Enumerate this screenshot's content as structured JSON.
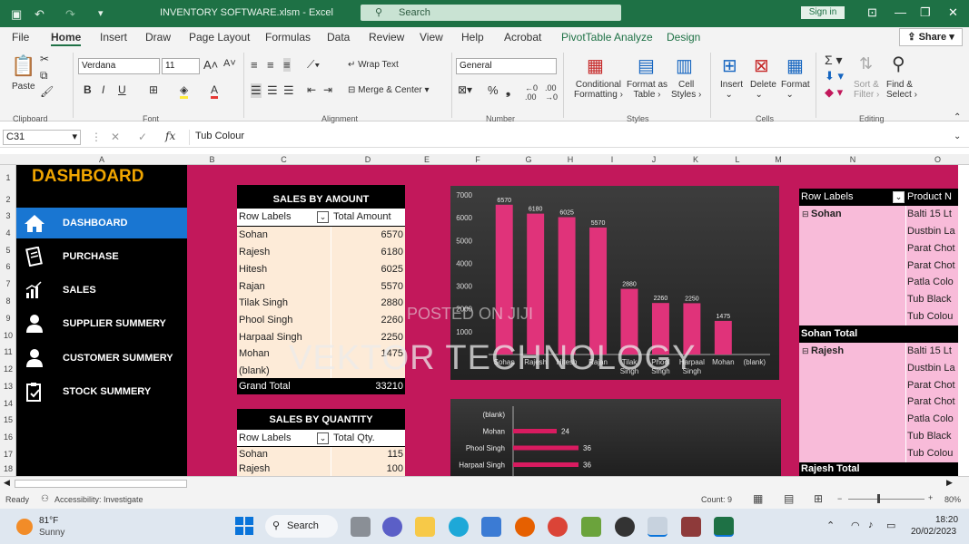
{
  "titlebar": {
    "file_title": "INVENTORY SOFTWARE.xlsm  -  Excel",
    "search_placeholder": "Search",
    "signin": "Sign in"
  },
  "tabs": [
    "File",
    "Home",
    "Insert",
    "Draw",
    "Page Layout",
    "Formulas",
    "Data",
    "Review",
    "View",
    "Help",
    "Acrobat",
    "PivotTable Analyze",
    "Design"
  ],
  "share": "Share",
  "ribbon": {
    "paste": "Paste",
    "clipboard": "Clipboard",
    "font_name": "Verdana",
    "font_size": "11",
    "font": "Font",
    "wrap_text": "Wrap Text",
    "merge_center": "Merge & Center",
    "alignment": "Alignment",
    "number_format": "General",
    "number": "Number",
    "cond_format": "Conditional",
    "cond_format2": "Formatting",
    "format_as": "Format as",
    "format_as2": "Table",
    "cell_styles": "Cell",
    "cell_styles2": "Styles",
    "styles": "Styles",
    "insert": "Insert",
    "delete": "Delete",
    "format": "Format",
    "cells": "Cells",
    "sort_filter": "Sort &",
    "sort_filter2": "Filter",
    "find_select": "Find &",
    "find_select2": "Select",
    "editing": "Editing"
  },
  "formula_bar": {
    "name_box": "C31",
    "fx": "fx",
    "formula": "Tub Colour"
  },
  "columns": [
    "A",
    "B",
    "C",
    "D",
    "E",
    "F",
    "G",
    "H",
    "I",
    "J",
    "K",
    "L",
    "M",
    "N",
    "O"
  ],
  "rows": [
    "1",
    "2",
    "3",
    "4",
    "5",
    "6",
    "7",
    "8",
    "9",
    "10",
    "11",
    "12",
    "13",
    "14",
    "15",
    "16",
    "17",
    "18"
  ],
  "dashboard": {
    "title": "DASHBOARD",
    "nav": [
      {
        "label": "DASHBOARD",
        "icon": "home-icon"
      },
      {
        "label": "PURCHASE",
        "icon": "receipt-icon"
      },
      {
        "label": "SALES",
        "icon": "bar-chart-icon"
      },
      {
        "label": "SUPPLIER SUMMERY",
        "icon": "person-icon"
      },
      {
        "label": "CUSTOMER SUMMERY",
        "icon": "person-icon"
      },
      {
        "label": "STOCK SUMMERY",
        "icon": "clipboard-check-icon"
      }
    ]
  },
  "sales_by_amount": {
    "title": "SALES BY AMOUNT",
    "col1": "Row Labels",
    "col2": "Total Amount",
    "rows": [
      [
        "Sohan",
        "6570"
      ],
      [
        "Rajesh",
        "6180"
      ],
      [
        "Hitesh",
        "6025"
      ],
      [
        "Rajan",
        "5570"
      ],
      [
        "Tilak Singh",
        "2880"
      ],
      [
        "Phool Singh",
        "2260"
      ],
      [
        "Harpaal Singh",
        "2250"
      ],
      [
        "Mohan",
        "1475"
      ],
      [
        "(blank)",
        ""
      ]
    ],
    "total_label": "Grand Total",
    "total_value": "33210"
  },
  "sales_by_quantity": {
    "title": "SALES BY QUANTITY",
    "col1": "Row Labels",
    "col2": "Total Qty.",
    "rows": [
      [
        "Sohan",
        "115"
      ],
      [
        "Rajesh",
        "100"
      ]
    ]
  },
  "chart_data": [
    {
      "type": "bar",
      "categories": [
        "Sohan",
        "Rajesh",
        "Hitesh",
        "Rajan",
        "Tilak Singh",
        "Phool Singh",
        "Harpaal Singh",
        "Mohan",
        "(blank)"
      ],
      "values": [
        6570,
        6180,
        6025,
        5570,
        2880,
        2260,
        2250,
        1475,
        null
      ],
      "ylim": [
        0,
        7000
      ],
      "yticks": [
        "7000",
        "6000",
        "5000",
        "4000",
        "3000",
        "2000",
        "1000"
      ],
      "bar_color": "#e0337a"
    },
    {
      "type": "bar",
      "orientation": "horizontal",
      "categories": [
        "(blank)",
        "Mohan",
        "Phool Singh",
        "Harpaal Singh"
      ],
      "values": [
        null,
        24,
        36,
        36
      ],
      "bar_color": "#d81b60"
    }
  ],
  "pivot_right": {
    "col1": "Row Labels",
    "col2": "Product N",
    "groups": [
      {
        "name": "Sohan",
        "items": [
          "Balti 15 Lt",
          "Dustbin La",
          "Parat Chot",
          "Parat Chot",
          "Patla Colo",
          "Tub Black",
          "Tub Colou"
        ],
        "total": "Sohan Total"
      },
      {
        "name": "Rajesh",
        "items": [
          "Balti 15 Lt",
          "Dustbin La",
          "Parat Chot",
          "Parat Chot",
          "Patla Colo",
          "Tub Black",
          "Tub Colou"
        ],
        "total": "Rajesh Total"
      }
    ]
  },
  "watermark": "VEKTOR TECHNOLOGY",
  "watermark2": "POSTED ON JIJI",
  "status": {
    "ready": "Ready",
    "accessibility": "Accessibility: Investigate",
    "count": "Count: 9",
    "zoom": "80%"
  },
  "taskbar": {
    "temp": "81°F",
    "weather": "Sunny",
    "search": "Search",
    "time": "18:20",
    "date": "20/02/2023"
  }
}
